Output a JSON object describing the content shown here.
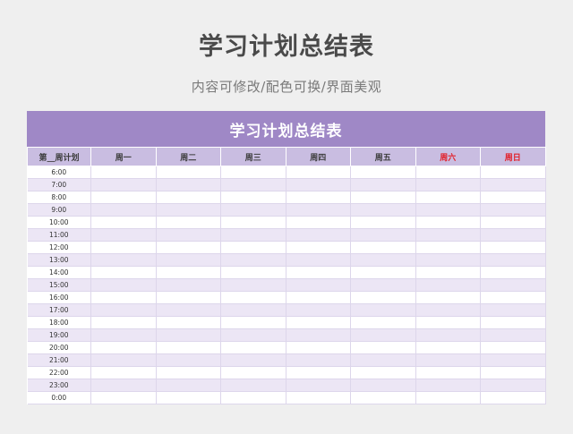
{
  "header": {
    "title": "学习计划总结表",
    "subtitle": "内容可修改/配色可换/界面美观"
  },
  "sheet": {
    "banner": "学习计划总结表",
    "columns": [
      "第__周计划",
      "周一",
      "周二",
      "周三",
      "周四",
      "周五",
      "周六",
      "周日"
    ],
    "times": [
      "6:00",
      "7:00",
      "8:00",
      "9:00",
      "10:00",
      "11:00",
      "12:00",
      "13:00",
      "14:00",
      "15:00",
      "16:00",
      "17:00",
      "18:00",
      "19:00",
      "20:00",
      "21:00",
      "22:00",
      "23:00",
      "0:00"
    ]
  },
  "colors": {
    "banner": "#9f88c6",
    "header_row": "#c9bde1",
    "stripe": "#ece6f5",
    "weekend_text": "#e2202a"
  }
}
